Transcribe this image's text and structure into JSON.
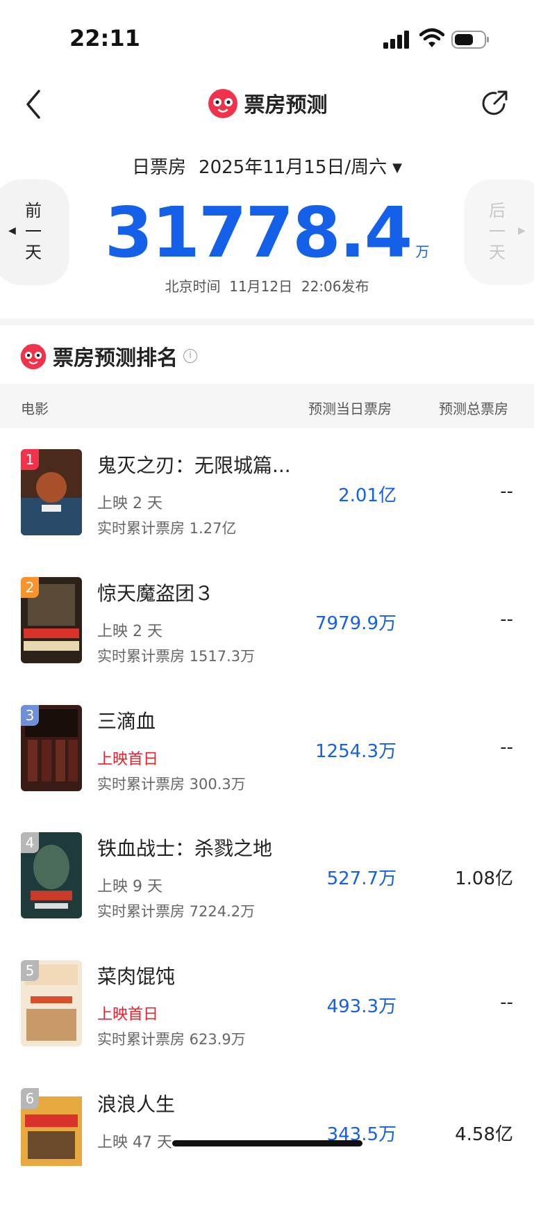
{
  "status_bar": {
    "time": "22:11"
  },
  "nav": {
    "title": "票房预测"
  },
  "date_bar": {
    "label": "日票房",
    "date": "2025年11月15日/周六"
  },
  "prev_day": {
    "label": "前一天"
  },
  "next_day": {
    "label": "后一天"
  },
  "main": {
    "value": "31778.4",
    "unit": "万",
    "publish": "北京时间  11月12日  22:06发布"
  },
  "section": {
    "title": "票房预测排名"
  },
  "table": {
    "headers": {
      "movie": "电影",
      "daily": "预测当日票房",
      "total": "预测总票房"
    },
    "rows": [
      {
        "rank": "1",
        "name": "鬼灭之刃：无限城篇...",
        "days": "上映 2 天",
        "first_day": false,
        "cumulative": "实时累计票房 1.27亿",
        "predicted_daily": "2.01亿",
        "predicted_total": "--",
        "rank_color": "#f0334a"
      },
      {
        "rank": "2",
        "name": "惊天魔盗团３",
        "days": "上映 2 天",
        "first_day": false,
        "cumulative": "实时累计票房 1517.3万",
        "predicted_daily": "7979.9万",
        "predicted_total": "--",
        "rank_color": "#f7932a"
      },
      {
        "rank": "3",
        "name": "三滴血",
        "days": "上映首日",
        "first_day": true,
        "cumulative": "实时累计票房 300.3万",
        "predicted_daily": "1254.3万",
        "predicted_total": "--",
        "rank_color": "#6f8fd8"
      },
      {
        "rank": "4",
        "name": "铁血战士：杀戮之地",
        "days": "上映 9 天",
        "first_day": false,
        "cumulative": "实时累计票房 7224.2万",
        "predicted_daily": "527.7万",
        "predicted_total": "1.08亿",
        "rank_color": "#b7b7b7"
      },
      {
        "rank": "5",
        "name": "菜肉馄饨",
        "days": "上映首日",
        "first_day": true,
        "cumulative": "实时累计票房 623.9万",
        "predicted_daily": "493.3万",
        "predicted_total": "--",
        "rank_color": "#b7b7b7"
      },
      {
        "rank": "6",
        "name": "浪浪人生",
        "days": "上映 47 天",
        "first_day": false,
        "cumulative": "",
        "predicted_daily": "343.5万",
        "predicted_total": "4.58亿",
        "rank_color": "#b7b7b7"
      }
    ]
  },
  "colors": {
    "accent": "#1560e8",
    "brand": "#f0334a",
    "first_day": "#e8202c"
  }
}
